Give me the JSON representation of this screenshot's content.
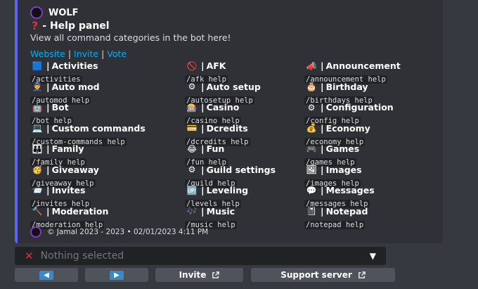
{
  "embed": {
    "author": "WOLF",
    "title_icon": "question-mark",
    "title": "- Help panel",
    "description": "View all command categories in the bot here!",
    "links": [
      {
        "label": "Website"
      },
      {
        "label": "Invite"
      },
      {
        "label": "Vote"
      }
    ],
    "link_separator": "|",
    "fields": [
      {
        "icon": "🟦",
        "name": "Activities",
        "value": "/activities"
      },
      {
        "icon": "🚫",
        "name": "AFK",
        "value": "/afk help"
      },
      {
        "icon": "📣",
        "name": "Announcement",
        "value": "/announcement help"
      },
      {
        "icon": "👮",
        "name": "Auto mod",
        "value": "/automod help"
      },
      {
        "icon": "⚙",
        "name": "Auto setup",
        "value": "/autosetup help"
      },
      {
        "icon": "🎂",
        "name": "Birthday",
        "value": "/birthdays help"
      },
      {
        "icon": "🤖",
        "name": "Bot",
        "value": "/bot help"
      },
      {
        "icon": "🎰",
        "name": "Casino",
        "value": "/casino help"
      },
      {
        "icon": "⚙",
        "name": "Configuration",
        "value": "/config help"
      },
      {
        "icon": "💻",
        "name": "Custom commands",
        "value": "/custom-commands help"
      },
      {
        "icon": "💳",
        "name": "Dcredits",
        "value": "/dcredits help"
      },
      {
        "icon": "💰",
        "name": "Economy",
        "value": "/economy help"
      },
      {
        "icon": "👪",
        "name": "Family",
        "value": "/family help"
      },
      {
        "icon": "😂",
        "name": "Fun",
        "value": "/fun help"
      },
      {
        "icon": "🎮",
        "name": "Games",
        "value": "/games help"
      },
      {
        "icon": "🥳",
        "name": "Giveaway",
        "value": "/giveaway help"
      },
      {
        "icon": "⚙",
        "name": "Guild settings",
        "value": "/guild help"
      },
      {
        "icon": "🖼",
        "name": "Images",
        "value": "/images help"
      },
      {
        "icon": "📨",
        "name": "Invites",
        "value": "/invites help"
      },
      {
        "icon": "🆙",
        "name": "Leveling",
        "value": "/levels help"
      },
      {
        "icon": "💬",
        "name": "Messages",
        "value": "/messages help"
      },
      {
        "icon": "🔨",
        "name": "Moderation",
        "value": "/moderation help"
      },
      {
        "icon": "🎶",
        "name": "Music",
        "value": "/music help"
      },
      {
        "icon": "📓",
        "name": "Notepad",
        "value": "/notepad help"
      }
    ],
    "field_separator": "|",
    "footer": "© Jamal 2023 - 2023 • 02/01/2023 4:11 PM"
  },
  "select": {
    "icon": "x-mark",
    "placeholder": "Nothing selected"
  },
  "buttons": [
    {
      "icon": "arrow-left"
    },
    {
      "icon": "arrow-right"
    },
    {
      "label": "Invite"
    },
    {
      "label": "Support server"
    }
  ],
  "colors": {
    "accent": "#5865f2",
    "link": "#00aff4",
    "button": "#4f545c",
    "background": "#36393f",
    "embed": "#2f3136"
  }
}
